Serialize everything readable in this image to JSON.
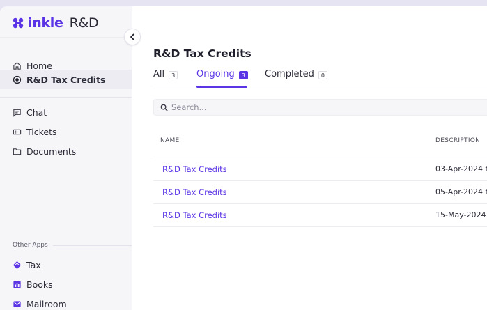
{
  "brand": {
    "name": "inkle",
    "suffix": "R&D",
    "color": "#5b34e6"
  },
  "nav": {
    "primary": [
      {
        "label": "Home",
        "icon": "home-icon"
      },
      {
        "label": "R&D Tax Credits",
        "icon": "target-icon",
        "active": true
      }
    ],
    "secondary": [
      {
        "label": "Chat",
        "icon": "chat-icon"
      },
      {
        "label": "Tickets",
        "icon": "ticket-icon"
      },
      {
        "label": "Documents",
        "icon": "folder-icon"
      }
    ],
    "other_apps_label": "Other Apps",
    "other_apps": [
      {
        "label": "Tax",
        "icon": "tax-diamond-icon",
        "color": "#5b34e6"
      },
      {
        "label": "Books",
        "icon": "books-chart-icon",
        "color": "#5b34e6"
      },
      {
        "label": "Mailroom",
        "icon": "mail-icon",
        "color": "#5b34e6"
      }
    ]
  },
  "page": {
    "title": "R&D Tax Credits"
  },
  "tabs": [
    {
      "label": "All",
      "count": "3"
    },
    {
      "label": "Ongoing",
      "count": "3",
      "active": true
    },
    {
      "label": "Completed",
      "count": "0"
    }
  ],
  "search": {
    "placeholder": "Search..."
  },
  "table": {
    "columns": [
      "NAME",
      "DESCRIPTION"
    ],
    "rows": [
      {
        "name": "R&D Tax Credits",
        "description": "03-Apr-2024 t"
      },
      {
        "name": "R&D Tax Credits",
        "description": "05-Apr-2024 t"
      },
      {
        "name": "R&D Tax Credits",
        "description": "15-May-2024 t"
      }
    ]
  }
}
